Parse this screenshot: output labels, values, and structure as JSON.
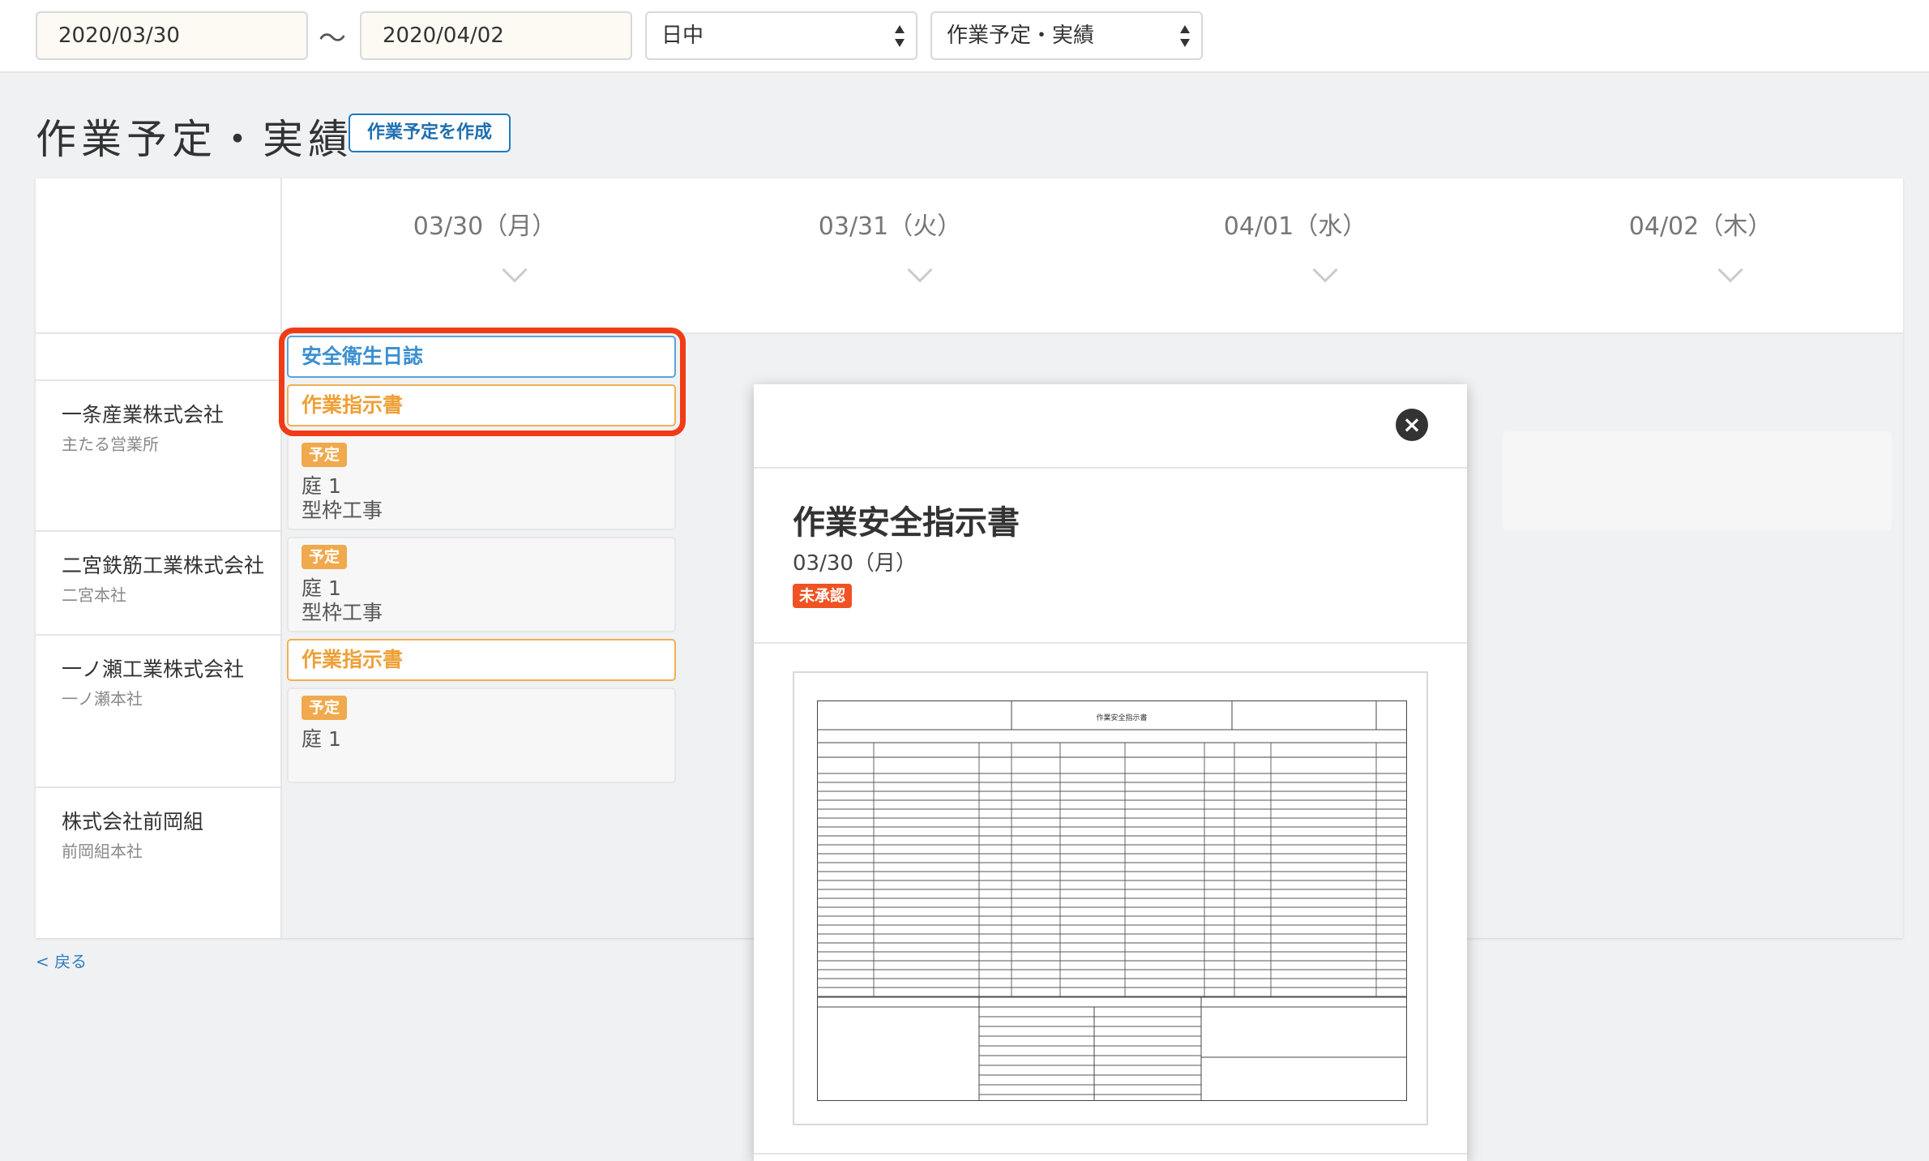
{
  "filters": {
    "date_from": "2020/03/30",
    "tilde": "〜",
    "date_to": "2020/04/02",
    "shift": "日中",
    "view": "作業予定・実績"
  },
  "page": {
    "title": "作業予定・実績",
    "create_button": "作業予定を作成",
    "back_link": "< 戻る"
  },
  "dates": [
    "03/30（月）",
    "03/31（火）",
    "04/01（水）",
    "04/02（木）"
  ],
  "companies": [
    {
      "name": "一条産業株式会社",
      "office": "主たる営業所"
    },
    {
      "name": "二宮鉄筋工業株式会社",
      "office": "二宮本社"
    },
    {
      "name": "一ノ瀬工業株式会社",
      "office": "一ノ瀬本社"
    },
    {
      "name": "株式会社前岡組",
      "office": "前岡組本社"
    }
  ],
  "cells": {
    "safety_diary": "安全衛生日誌",
    "work_instruction": "作業指示書",
    "plan_badge": "予定",
    "plan1": {
      "line1": "庭 1",
      "line2": "型枠工事"
    },
    "plan2": {
      "line1": "庭 1",
      "line2": "型枠工事"
    },
    "plan3": {
      "line1": "庭 1"
    }
  },
  "modal": {
    "title": "作業安全指示書",
    "date": "03/30（月）",
    "status": "未承認",
    "doc_title": "作業安全指示書"
  },
  "colors": {
    "accent_blue": "#1f7ac0",
    "orange": "#f0a94c",
    "highlight_red": "#f03c16",
    "status_red": "#ef5323"
  }
}
